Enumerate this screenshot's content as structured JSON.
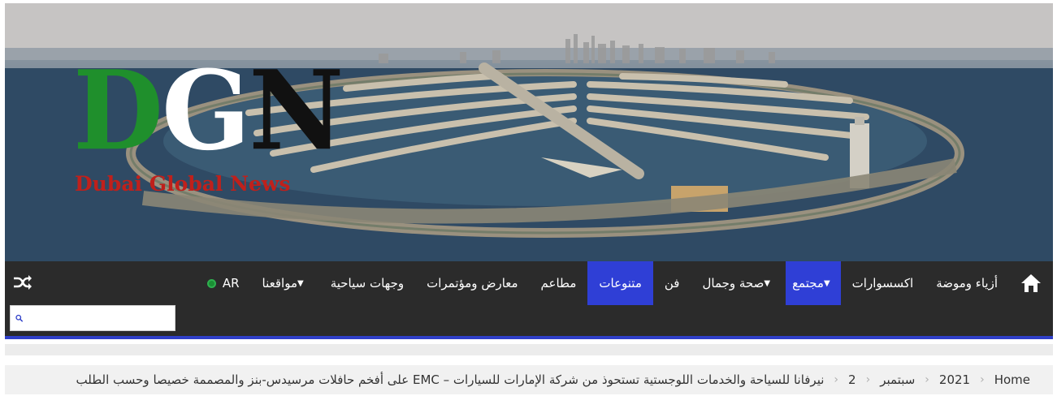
{
  "logo": {
    "letters": [
      "D",
      "G",
      "N"
    ],
    "subtitle": "Dubai Global News"
  },
  "colors": {
    "nav_bg": "#2b2b2b",
    "nav_active": "#2f3fd6",
    "accent_border": "#2f3fc8",
    "logo_green": "#1f8f2c",
    "logo_red": "#c0201b"
  },
  "nav": {
    "home_icon": "home-icon",
    "items": [
      {
        "label": "أزياء وموضة",
        "active": false,
        "dropdown": false
      },
      {
        "label": "اكسسوارات",
        "active": false,
        "dropdown": false
      },
      {
        "label": "مجتمع",
        "active": true,
        "dropdown": true
      },
      {
        "label": "صحة وجمال",
        "active": false,
        "dropdown": true
      },
      {
        "label": "فن",
        "active": false,
        "dropdown": false
      },
      {
        "label": "متنوعات",
        "active": true,
        "dropdown": false
      },
      {
        "label": "مطاعم",
        "active": false,
        "dropdown": false
      },
      {
        "label": "معارض ومؤتمرات",
        "active": false,
        "dropdown": false
      },
      {
        "label": "وجهات سياحية",
        "active": false,
        "dropdown": false
      },
      {
        "label": "مواقعنا",
        "active": false,
        "dropdown": true
      }
    ],
    "language": "AR",
    "shuffle_icon": "shuffle-icon"
  },
  "search": {
    "placeholder": "",
    "value": ""
  },
  "breadcrumb": {
    "home": "Home",
    "year": "2021",
    "month": "سبتمبر",
    "day": "2",
    "title": "نيرفانا للسياحة والخدمات اللوجستية تستحوذ من شركة الإمارات للسيارات – EMC على أفخم حافلات مرسيدس-بنز والمصممة خصيصا وحسب الطلب"
  }
}
